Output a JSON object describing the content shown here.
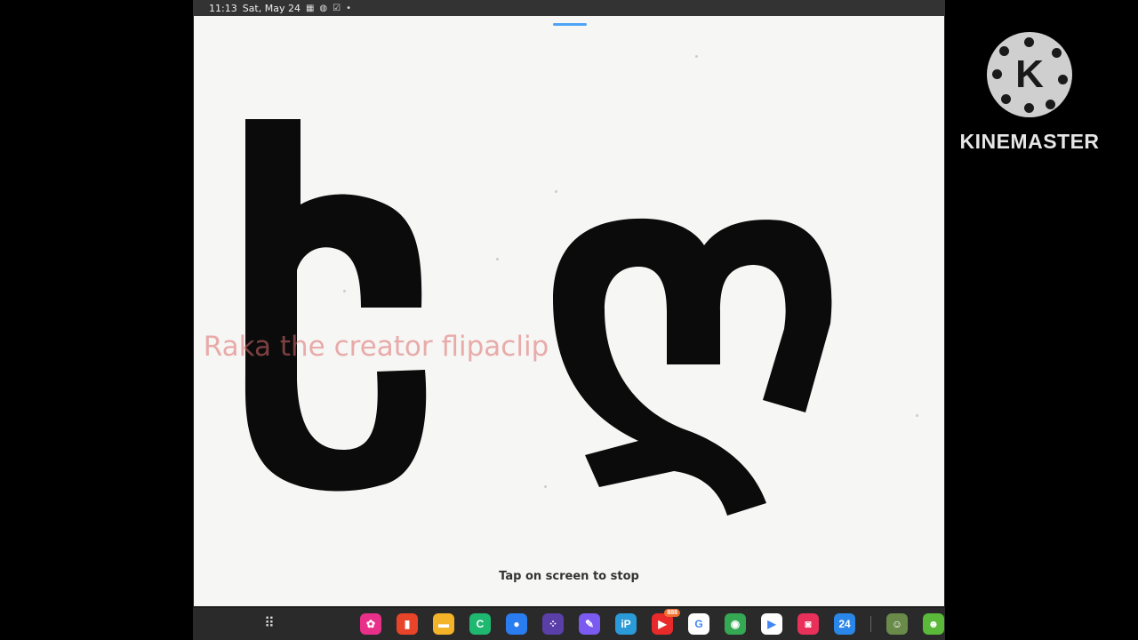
{
  "status_bar": {
    "time": "11:13",
    "date": "Sat, May 24",
    "icons": [
      "gallery-notification-icon",
      "messenger-notification-icon",
      "check-notification-icon",
      "more-dot-icon"
    ]
  },
  "canvas": {
    "watermark": "Raka the creator flipaclip",
    "stop_hint": "Tap on screen to stop",
    "glyphs": "ចា"
  },
  "taskbar": {
    "apps_icon": "apps-grid-icon",
    "apps": [
      {
        "name": "flower-app",
        "color": "#e8308a",
        "glyph": "✿"
      },
      {
        "name": "flipaclip-app",
        "color": "#e8442a",
        "glyph": "▮"
      },
      {
        "name": "files-app",
        "color": "#f4b42a",
        "glyph": "▬"
      },
      {
        "name": "capcut-app",
        "color": "#1eb870",
        "glyph": "C"
      },
      {
        "name": "messages-app",
        "color": "#2a7df0",
        "glyph": "●"
      },
      {
        "name": "multi-app",
        "color": "#5a3fa8",
        "glyph": "⁘"
      },
      {
        "name": "pen-app",
        "color": "#7a5af0",
        "glyph": "✎"
      },
      {
        "name": "ibis-paint-app",
        "color": "#2a9ad8",
        "glyph": "iP"
      },
      {
        "name": "youtube-app",
        "color": "#e82a2a",
        "glyph": "▶",
        "badge": "888"
      },
      {
        "name": "google-app",
        "color": "#ffffff",
        "glyph": "G"
      },
      {
        "name": "maps-app",
        "color": "#34a853",
        "glyph": "◉"
      },
      {
        "name": "play-store-app",
        "color": "#ffffff",
        "glyph": "▶"
      },
      {
        "name": "screen-recorder-app",
        "color": "#e8305a",
        "glyph": "◙"
      },
      {
        "name": "calendar-app",
        "color": "#2a86e8",
        "glyph": "24"
      },
      {
        "name": "avatar-app",
        "color": "#6a8a4a",
        "glyph": "☺"
      },
      {
        "name": "android-app",
        "color": "#5ab83a",
        "glyph": "☻"
      }
    ]
  },
  "brand": {
    "logo_letter": "K",
    "name": "KINEMASTER"
  }
}
